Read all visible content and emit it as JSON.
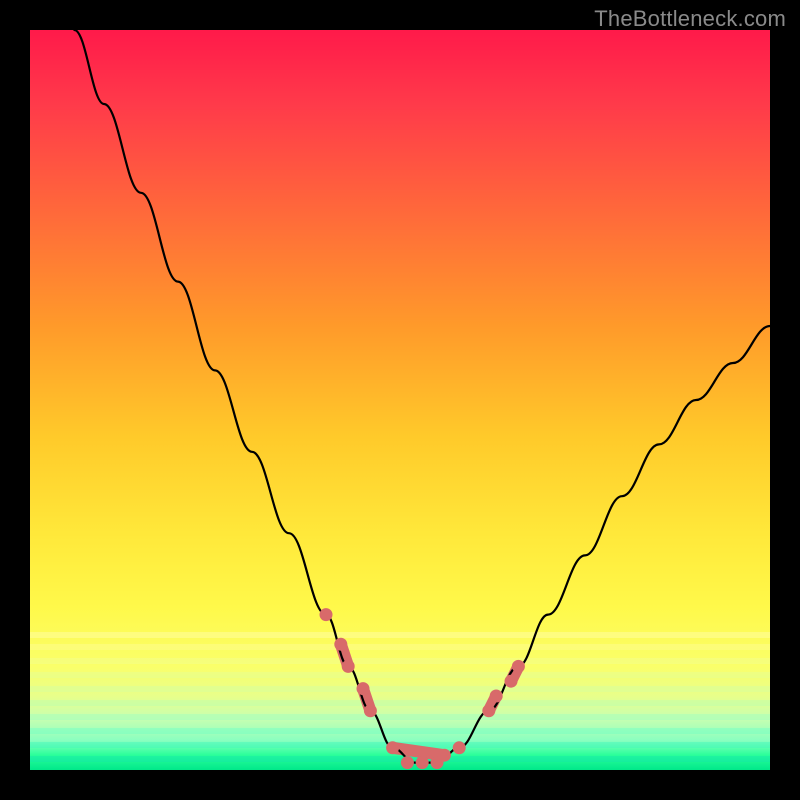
{
  "watermark": {
    "text": "TheBottleneck.com"
  },
  "chart_data": {
    "type": "line",
    "title": "",
    "xlabel": "",
    "ylabel": "",
    "xlim": [
      0,
      100
    ],
    "ylim": [
      0,
      100
    ],
    "series": [
      {
        "name": "bottleneck-curve",
        "x": [
          6,
          10,
          15,
          20,
          25,
          30,
          35,
          40,
          43,
          46,
          49,
          52,
          55,
          58,
          62,
          66,
          70,
          75,
          80,
          85,
          90,
          95,
          100
        ],
        "y": [
          100,
          90,
          78,
          66,
          54,
          43,
          32,
          21,
          14,
          8,
          3,
          1,
          1,
          3,
          8,
          14,
          21,
          29,
          37,
          44,
          50,
          55,
          60
        ]
      }
    ],
    "markers": {
      "name": "highlight-points",
      "x": [
        40,
        42,
        43,
        45,
        46,
        49,
        51,
        53,
        55,
        56,
        58,
        62,
        63,
        65,
        66
      ],
      "y": [
        21,
        17,
        14,
        11,
        8,
        3,
        1,
        1,
        1,
        2,
        3,
        8,
        10,
        12,
        14
      ]
    },
    "marker_segments": [
      {
        "x1": 42,
        "y1": 17,
        "x2": 43,
        "y2": 14
      },
      {
        "x1": 45,
        "y1": 11,
        "x2": 46,
        "y2": 8
      },
      {
        "x1": 49,
        "y1": 3,
        "x2": 56,
        "y2": 2
      },
      {
        "x1": 62,
        "y1": 8,
        "x2": 63,
        "y2": 10
      },
      {
        "x1": 65,
        "y1": 12,
        "x2": 66,
        "y2": 14
      }
    ],
    "colors": {
      "curve": "#000000",
      "marker": "#d86a6a"
    }
  }
}
